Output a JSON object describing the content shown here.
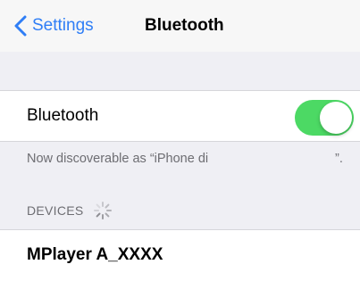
{
  "nav": {
    "back_label": "Settings",
    "title": "Bluetooth"
  },
  "bluetooth_row": {
    "label": "Bluetooth",
    "toggle_on": true
  },
  "discoverable": {
    "text": "Now discoverable as “iPhone di",
    "text_end": "”."
  },
  "devices": {
    "header": "DEVICES",
    "items": [
      {
        "name": "MPlayer A_XXXX"
      }
    ]
  },
  "colors": {
    "accent": "#2f7ef6",
    "toggle_on": "#4cd964",
    "background": "#efeff4",
    "secondary_text": "#6d6d72"
  },
  "icons": {
    "back": "chevron-left-icon",
    "spinner": "activity-spinner-icon"
  }
}
